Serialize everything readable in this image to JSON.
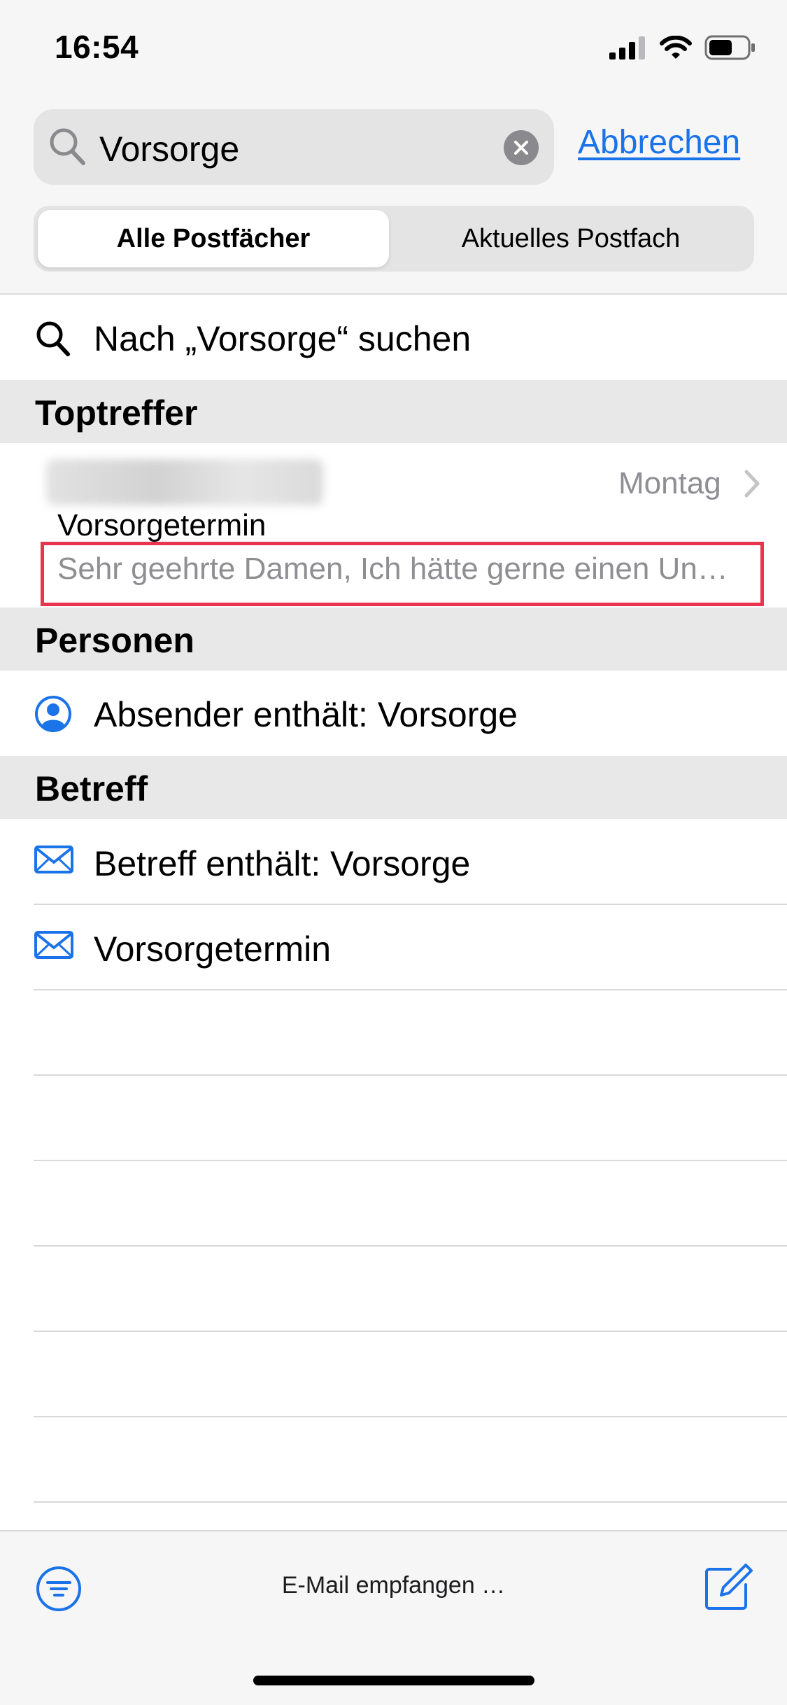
{
  "status_bar": {
    "time": "16:54",
    "icons": [
      "cellular-signal-icon",
      "wifi-icon",
      "battery-icon"
    ]
  },
  "search": {
    "query": "Vorsorge",
    "cancel_label": "Abbrechen"
  },
  "scope": {
    "options": [
      "Alle Postfächer",
      "Aktuelles Postfach"
    ],
    "selected": "Alle Postfächer"
  },
  "suggestion": {
    "label": "Nach „Vorsorge“ suchen"
  },
  "sections": {
    "top_hits": "Toptreffer",
    "people": "Personen",
    "subject": "Betreff"
  },
  "top_hit": {
    "date": "Montag",
    "subject": "Vorsorgetermin",
    "preview": "Sehr geehrte Damen, Ich hätte gerne einen Un…"
  },
  "people_rows": [
    {
      "label": "Absender enthält: Vorsorge",
      "icon": "person-circle-icon"
    }
  ],
  "subject_rows": [
    {
      "label": "Betreff enthält: Vorsorge",
      "icon": "envelope-icon"
    },
    {
      "label": "Vorsorgetermin",
      "icon": "envelope-icon"
    }
  ],
  "toolbar": {
    "status": "E-Mail empfangen …",
    "left_icon": "filter-icon",
    "right_icon": "compose-icon"
  },
  "colors": {
    "accent": "#1a73e8",
    "highlight_border": "#e8344e",
    "secondary_text": "#8e8e93"
  }
}
